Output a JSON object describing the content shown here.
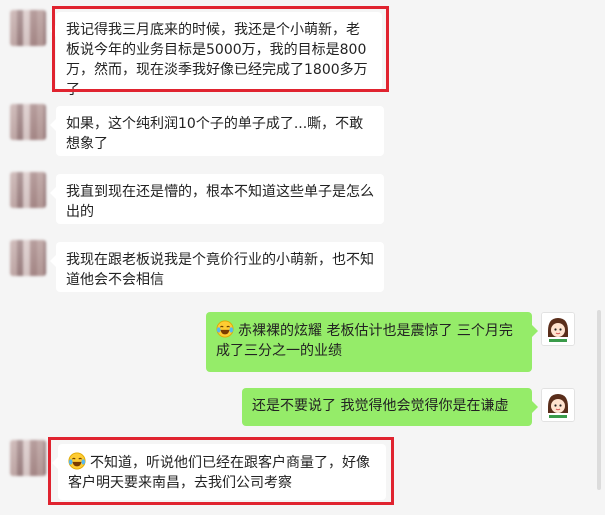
{
  "messages": [
    {
      "side": "left",
      "text": "我记得我三月底来的时候，我还是个小萌新，老板说今年的业务目标是5000万，我的目标是800万，然而，现在淡季我好像已经完成了1800多万了",
      "highlighted": true
    },
    {
      "side": "left",
      "text": "如果，这个纯利润10个子的单子成了...嘶，不敢想象了",
      "highlighted": false
    },
    {
      "side": "left",
      "text": "我直到现在还是懵的，根本不知道这些单子是怎么出的",
      "highlighted": false
    },
    {
      "side": "left",
      "text": "我现在跟老板说我是个竟价行业的小萌新，也不知道他会不会相信",
      "highlighted": false
    },
    {
      "side": "right",
      "emoji": "laughing-tears",
      "text": "赤裸裸的炫耀    老板估计也是震惊了  三个月完成了三分之一的业绩",
      "highlighted": false
    },
    {
      "side": "right",
      "text": "还是不要说了    我觉得他会觉得你是在谦虚",
      "highlighted": false
    },
    {
      "side": "left",
      "emoji": "laughing-tears",
      "text": "不知道，听说他们已经在跟客户商量了，好像客户明天要来南昌，去我们公司考察",
      "highlighted": true
    }
  ],
  "colors": {
    "background": "#f5f5f5",
    "left_bubble": "#ffffff",
    "right_bubble": "#95ec69",
    "highlight_border": "#e0232f"
  },
  "icons": {
    "left_avatar": "blurred-avatar",
    "right_avatar": "cartoon-girl-avatar",
    "emoji": "laughing-tears-emoji"
  }
}
